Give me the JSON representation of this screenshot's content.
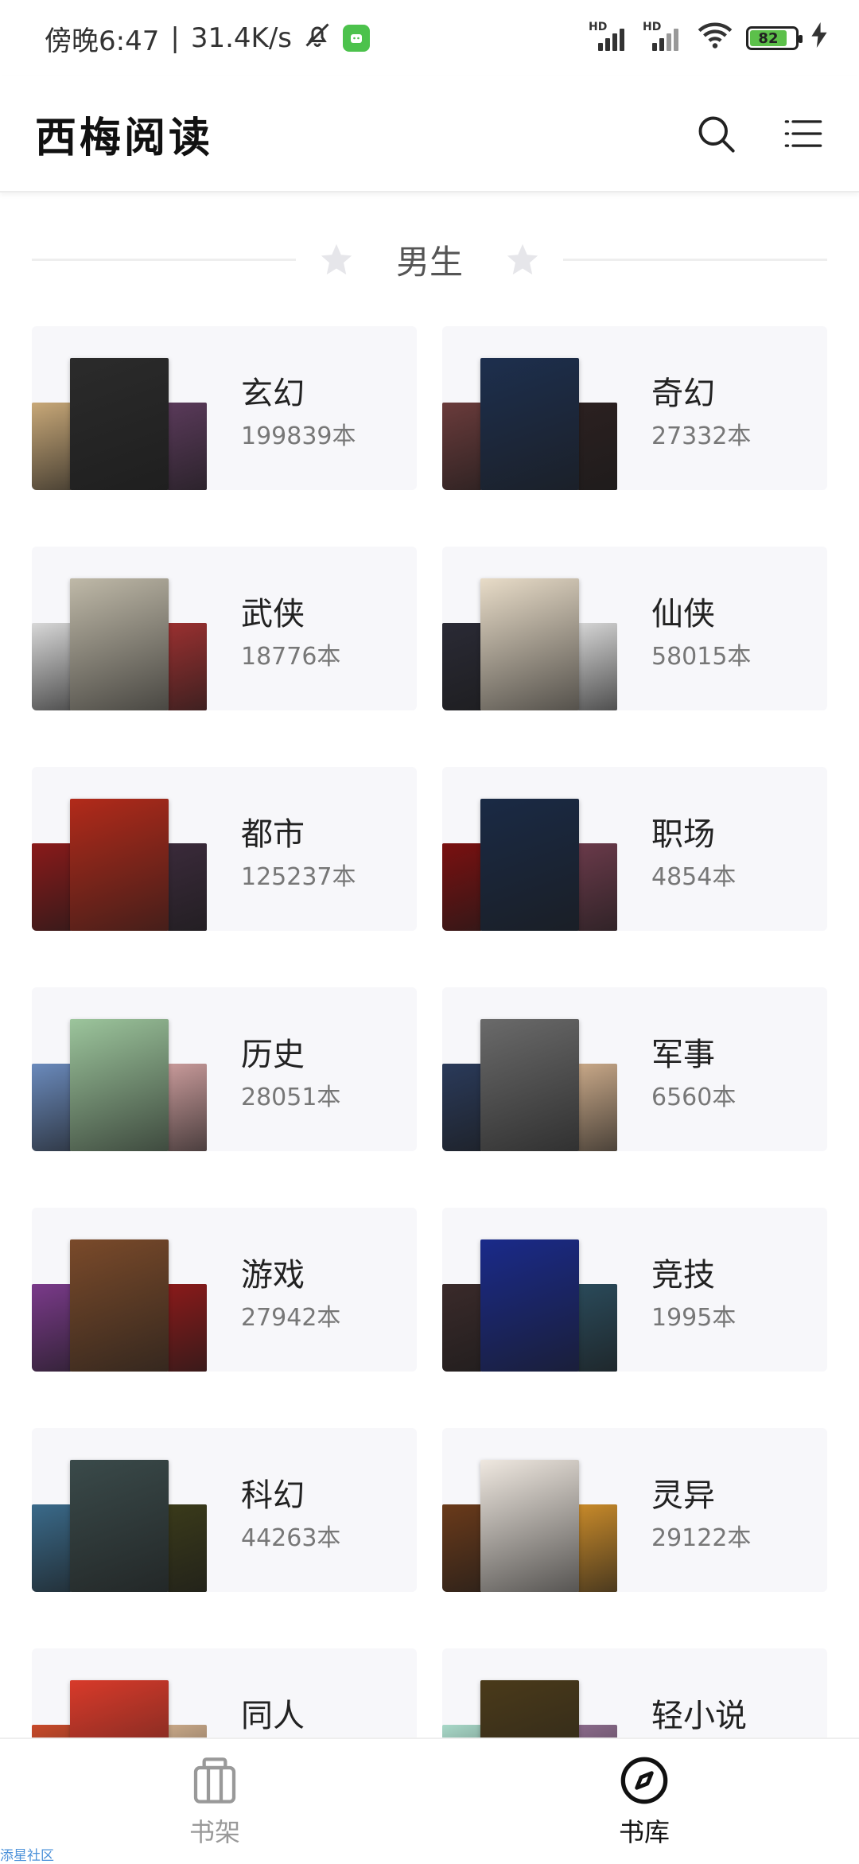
{
  "status_bar": {
    "time": "傍晚6:47",
    "net_speed": "31.4K/s",
    "hd1": "HD",
    "hd2": "HD",
    "battery": "82"
  },
  "header": {
    "title": "西梅阅读",
    "search_icon": "search-icon",
    "menu_icon": "menu-icon"
  },
  "section": {
    "title": "男生"
  },
  "categories": [
    {
      "name": "玄幻",
      "count": "199839本",
      "colors": [
        "#c8a878",
        "#2b2b2b",
        "#5a3a5a"
      ]
    },
    {
      "name": "奇幻",
      "count": "27332本",
      "colors": [
        "#6a3b3b",
        "#1d2f4e",
        "#2b2020"
      ]
    },
    {
      "name": "武侠",
      "count": "18776本",
      "colors": [
        "#d8d8d8",
        "#bfb9a8",
        "#9a3030"
      ]
    },
    {
      "name": "仙侠",
      "count": "58015本",
      "colors": [
        "#2a2a35",
        "#e8dcc8",
        "#d5d5d5"
      ]
    },
    {
      "name": "都市",
      "count": "125237本",
      "colors": [
        "#8a1a1a",
        "#b22a1a",
        "#3a2a3a"
      ]
    },
    {
      "name": "职场",
      "count": "4854本",
      "colors": [
        "#7a1010",
        "#1a2a45",
        "#6a3a4a"
      ]
    },
    {
      "name": "历史",
      "count": "28051本",
      "colors": [
        "#6a8abc",
        "#9cc59c",
        "#c89a9a"
      ]
    },
    {
      "name": "军事",
      "count": "6560本",
      "colors": [
        "#2a3a5a",
        "#6a6a6a",
        "#c8a888"
      ]
    },
    {
      "name": "游戏",
      "count": "27942本",
      "colors": [
        "#7a3a8a",
        "#7a4a2a",
        "#8a1a1a"
      ]
    },
    {
      "name": "竞技",
      "count": "1995本",
      "colors": [
        "#3a2a2a",
        "#1a2a8a",
        "#2a4a5a"
      ]
    },
    {
      "name": "科幻",
      "count": "44263本",
      "colors": [
        "#3a6a8a",
        "#3a4a4a",
        "#3a3a1a"
      ]
    },
    {
      "name": "灵异",
      "count": "29122本",
      "colors": [
        "#6a3a1a",
        "#efe8e0",
        "#c88a2a"
      ]
    },
    {
      "name": "同人",
      "count": "",
      "colors": [
        "#c84a2a",
        "#d83a2a",
        "#c8a888"
      ]
    },
    {
      "name": "轻小说",
      "count": "",
      "colors": [
        "#a8d8c8",
        "#4a3a1a",
        "#8a6a8a"
      ]
    }
  ],
  "bottom_nav": {
    "shelf_label": "书架",
    "library_label": "书库"
  },
  "watermark": "添星社区"
}
